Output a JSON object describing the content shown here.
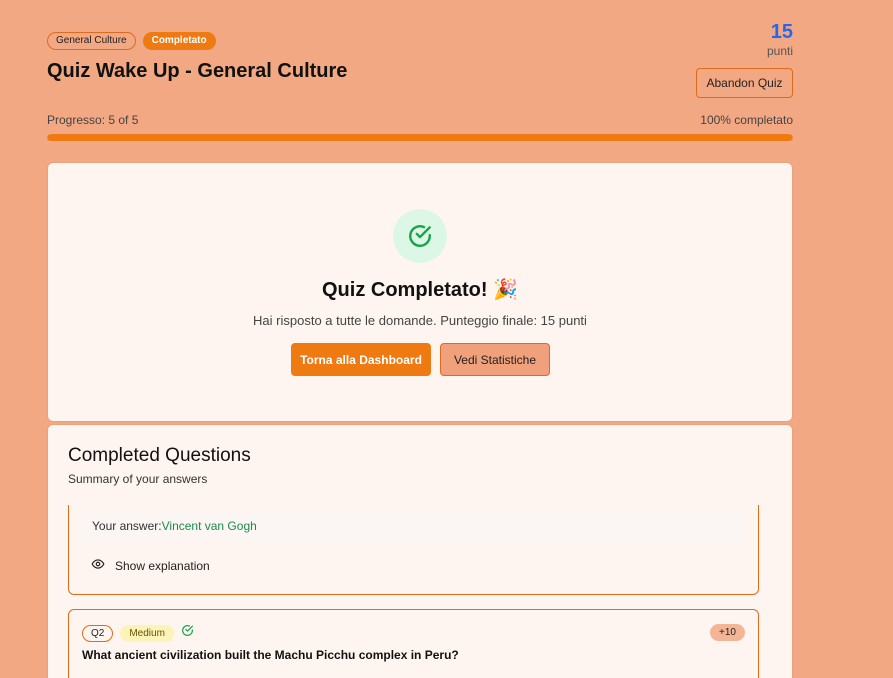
{
  "header": {
    "category_badge": "General Culture",
    "status_badge": "Completato",
    "title": "Quiz Wake Up - General Culture",
    "score": "15",
    "score_label": "punti",
    "abandon_label": "Abandon Quiz"
  },
  "progress": {
    "label": "Progresso: 5 of 5",
    "percent_label": "100% completato",
    "fraction": 1.0
  },
  "completion": {
    "title": "Quiz Completato! 🎉",
    "subtitle": "Hai risposto a tutte le domande. Punteggio finale: 15 punti",
    "primary_button": "Torna alla Dashboard",
    "secondary_button": "Vedi Statistiche"
  },
  "questions": {
    "title": "Completed Questions",
    "subtitle": "Summary of your answers",
    "items": [
      {
        "answer_label": "Your answer:",
        "answer_value": "Vincent van Gogh",
        "show_explanation": "Show explanation"
      },
      {
        "number": "Q2",
        "difficulty": "Medium",
        "points": "+10",
        "text": "What ancient civilization built the Machu Picchu complex in Peru?"
      }
    ]
  },
  "colors": {
    "accent": "#ef7a11",
    "background": "#f2a882",
    "score": "#2a66e8",
    "correct": "#1e8a4a"
  },
  "icons": {
    "completion": "check-circle-icon",
    "explanation": "eye-icon",
    "correct": "check-circle-small-icon"
  }
}
